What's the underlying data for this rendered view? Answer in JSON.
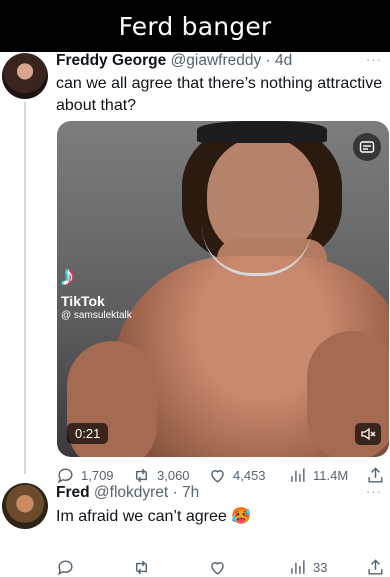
{
  "header": {
    "title": "Ferd banger"
  },
  "tweet1": {
    "name": "Freddy George",
    "handle": "@giawfreddy",
    "sep": " · ",
    "time": "4d",
    "text": "can we all agree that there’s nothing attractive about that?",
    "more": "···",
    "media": {
      "watermark_label": "TikTok",
      "watermark_user": "@ samsulektalk",
      "duration": "0:21"
    },
    "stats": {
      "replies": "1,709",
      "reposts": "3,060",
      "likes": "4,453",
      "views": "11.4M"
    }
  },
  "tweet2": {
    "name": "Fred",
    "handle": "@flokdyret",
    "sep": " · ",
    "time": "7h",
    "text": "Im afraid we can’t agree 🥵",
    "more": "···",
    "stats": {
      "views": "33"
    }
  }
}
